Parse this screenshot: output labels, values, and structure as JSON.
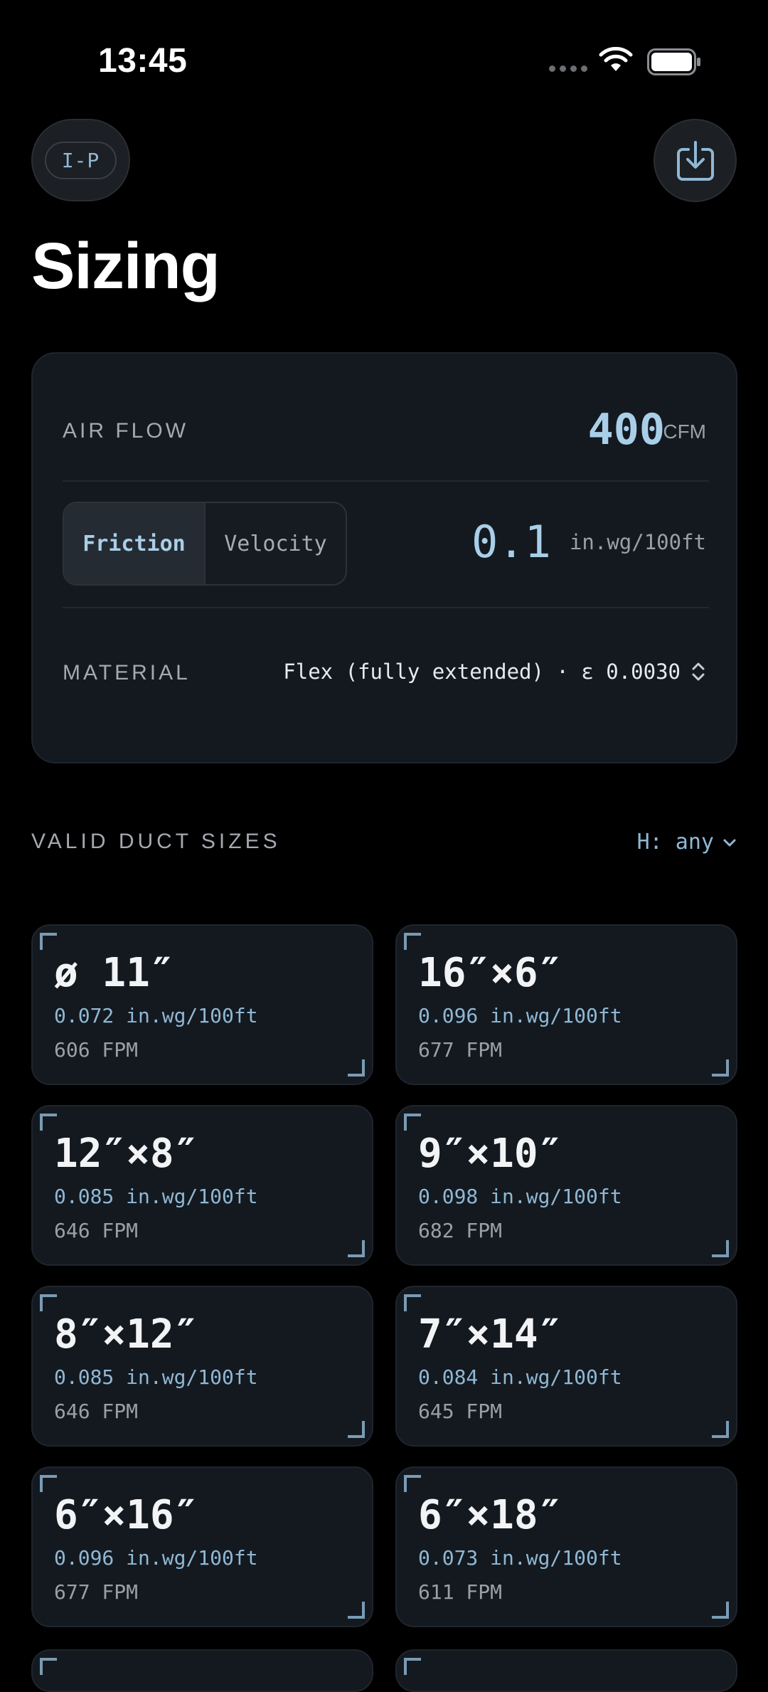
{
  "status": {
    "time": "13:45"
  },
  "header": {
    "unit_system": "I-P",
    "title": "Sizing"
  },
  "inputs": {
    "airflow_label": "AIR FLOW",
    "airflow_value": "400",
    "airflow_unit": "CFM",
    "mode_options": [
      "Friction",
      "Velocity"
    ],
    "mode_selected": "Friction",
    "friction_value": "0.1",
    "friction_unit": "in.wg/100ft",
    "material_label": "MATERIAL",
    "material_value": "Flex (fully extended) · ε 0.0030"
  },
  "results": {
    "section_title": "VALID DUCT SIZES",
    "height_filter": "H: any",
    "ducts": [
      {
        "size": "ø 11″",
        "friction": "0.072 in.wg/100ft",
        "velocity": "606 FPM"
      },
      {
        "size": "16″×6″",
        "friction": "0.096 in.wg/100ft",
        "velocity": "677 FPM"
      },
      {
        "size": "12″×8″",
        "friction": "0.085 in.wg/100ft",
        "velocity": "646 FPM"
      },
      {
        "size": "9″×10″",
        "friction": "0.098 in.wg/100ft",
        "velocity": "682 FPM"
      },
      {
        "size": "8″×12″",
        "friction": "0.085 in.wg/100ft",
        "velocity": "646 FPM"
      },
      {
        "size": "7″×14″",
        "friction": "0.084 in.wg/100ft",
        "velocity": "645 FPM"
      },
      {
        "size": "6″×16″",
        "friction": "0.096 in.wg/100ft",
        "velocity": "677 FPM"
      },
      {
        "size": "6″×18″",
        "friction": "0.073 in.wg/100ft",
        "velocity": "611 FPM"
      }
    ]
  },
  "icons": {
    "unit_toggle": "unit-system-toggle",
    "export": "download-tray-icon",
    "filter": "chevron-down-icon",
    "material": "chevron-up-down-icon"
  },
  "colors": {
    "accent": "#a9cfe8",
    "card": "#141920",
    "background": "#000000"
  }
}
